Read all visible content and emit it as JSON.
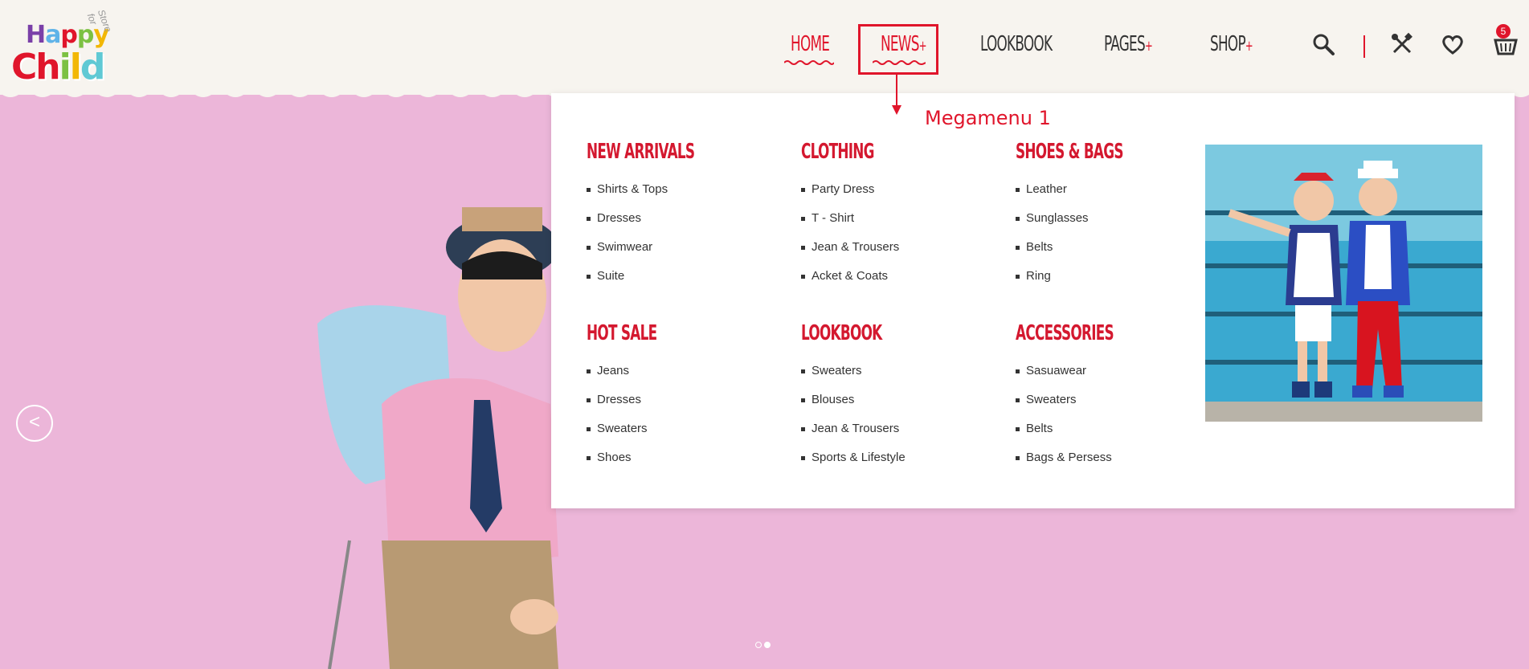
{
  "brand": {
    "word1": "Happy",
    "word2": "Child",
    "tagline": "Store for"
  },
  "nav": {
    "items": [
      {
        "label": "HOME",
        "plus": ""
      },
      {
        "label": "NEWS",
        "plus": "+"
      },
      {
        "label": "LOOKBOOK",
        "plus": ""
      },
      {
        "label": "PAGES",
        "plus": "+"
      },
      {
        "label": "SHOP",
        "plus": "+"
      }
    ],
    "cart_count": "5"
  },
  "annotation": {
    "label": "Megamenu 1"
  },
  "mega": {
    "columns": [
      {
        "title": "NEW ARRIVALS",
        "items": [
          "Shirts & Tops",
          "Dresses",
          "Swimwear",
          "Suite"
        ]
      },
      {
        "title": "CLOTHING",
        "items": [
          "Party Dress",
          "T - Shirt",
          "Jean & Trousers",
          "Acket & Coats"
        ]
      },
      {
        "title": "SHOES & BAGS",
        "items": [
          "Leather",
          "Sunglasses",
          "Belts",
          "Ring"
        ]
      },
      {
        "title": "HOT SALE",
        "items": [
          "Jeans",
          "Dresses",
          "Sweaters",
          "Shoes"
        ]
      },
      {
        "title": "LOOKBOOK",
        "items": [
          "Sweaters",
          "Blouses",
          "Jean & Trousers",
          "Sports & Lifestyle"
        ]
      },
      {
        "title": "ACCESSORIES",
        "items": [
          "Sasuawear",
          "Sweaters",
          "Belts",
          "Bags & Persess"
        ]
      }
    ]
  },
  "slider": {
    "prev": "<"
  },
  "colors": {
    "accent": "#e0152b",
    "hero_bg": "#ecb6d9"
  }
}
